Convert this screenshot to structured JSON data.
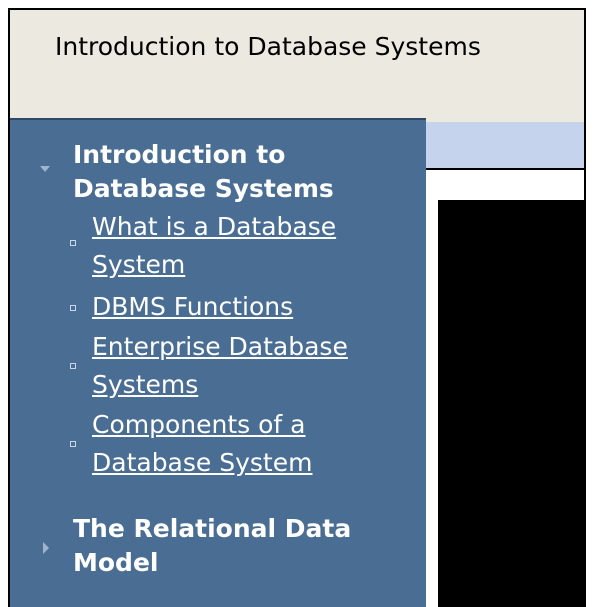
{
  "window": {
    "title": "Introduction to Database Systems"
  },
  "sidebar": {
    "sections": [
      {
        "title": "Introduction to Database Systems",
        "expanded": true,
        "items": [
          {
            "label": "What is a Database System"
          },
          {
            "label": "DBMS Functions"
          },
          {
            "label": "Enterprise Database Systems"
          },
          {
            "label": "Components of a Database System"
          }
        ]
      },
      {
        "title": "The Relational Data Model",
        "expanded": false,
        "items": []
      }
    ]
  },
  "colors": {
    "sidebar_bg": "#4a6e93",
    "title_bar_bg": "#ebe9e0",
    "header_strip": "#c5d3ec",
    "link": "#ffffff",
    "content_panel": "#000000"
  },
  "icons": {
    "expanded_section": "triangle-down-icon",
    "collapsed_section": "triangle-right-icon",
    "item_bullet": "square-bullet-icon"
  }
}
